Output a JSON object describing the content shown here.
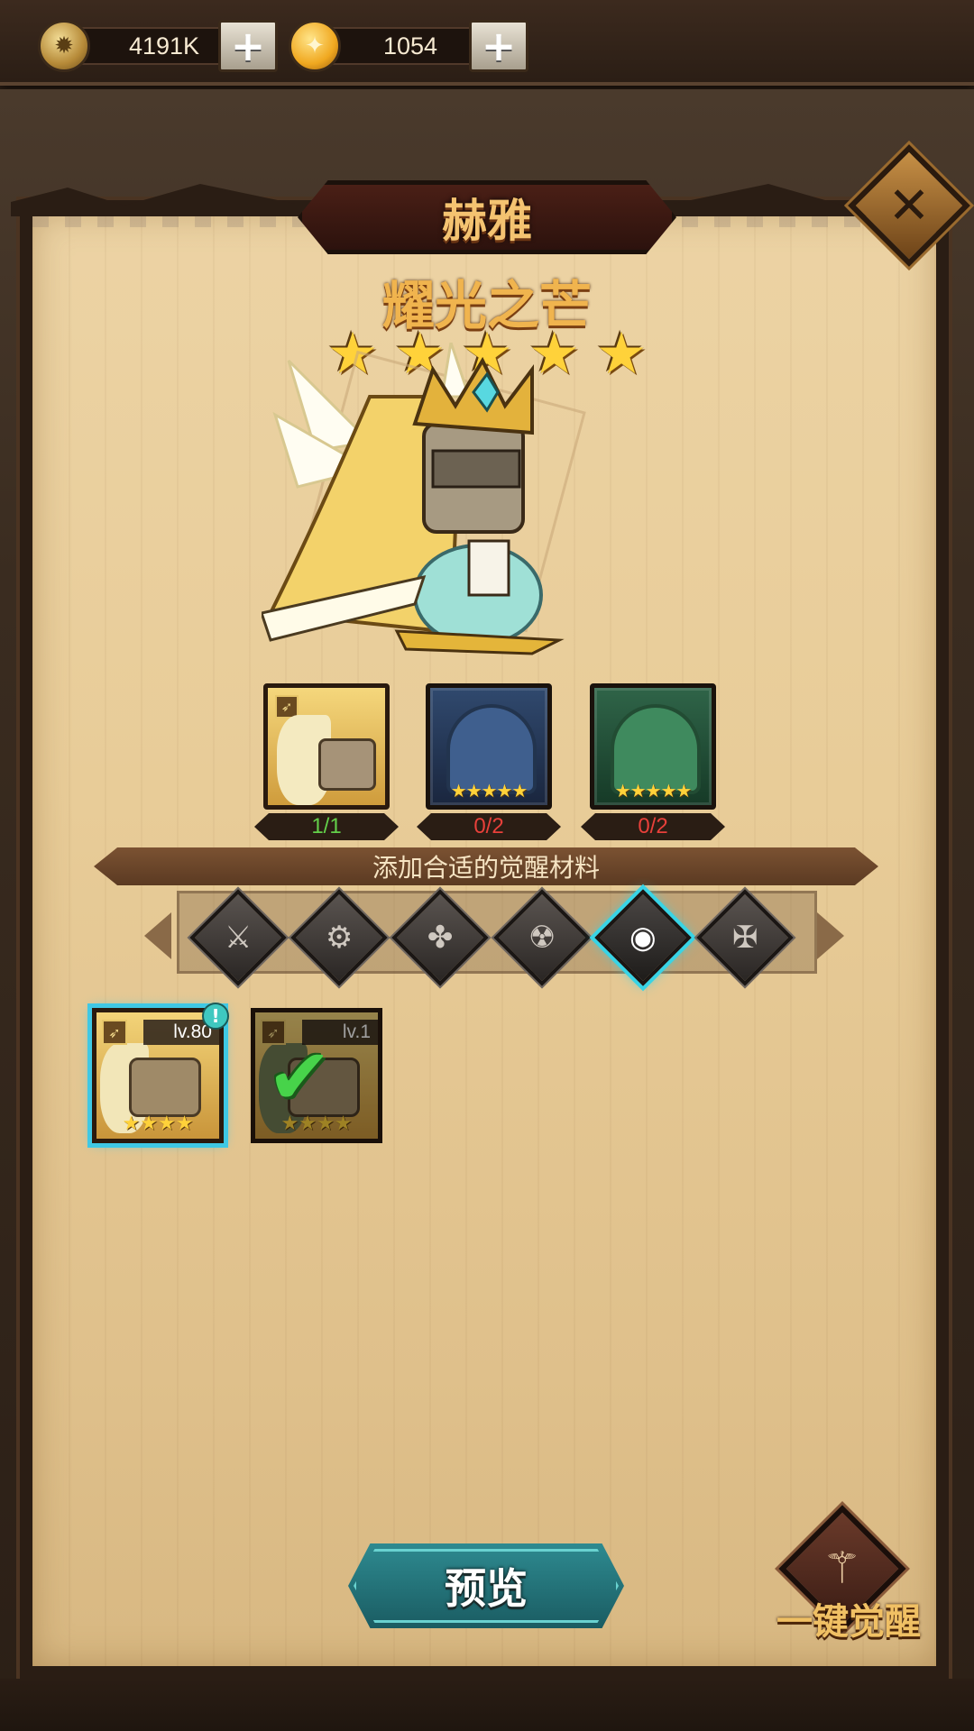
{
  "resources": {
    "stone": {
      "value": "4191K",
      "icon": "stone-coin-icon"
    },
    "gold": {
      "value": "1054",
      "icon": "gold-coin-icon"
    },
    "plus_label": "+"
  },
  "panel": {
    "title": "赫雅",
    "subtitle": "耀光之芒",
    "star_count": 5,
    "close_label": "✕"
  },
  "materials": [
    {
      "name": "hero-self",
      "count": "1/1",
      "status": "ok",
      "stars": ""
    },
    {
      "name": "blue-any",
      "count": "0/2",
      "status": "missing",
      "stars": "★★★★★"
    },
    {
      "name": "green-any",
      "count": "0/2",
      "status": "missing",
      "stars": "★★★★★"
    }
  ],
  "hint": "添加合适的觉醒材料",
  "factions": [
    {
      "icon": "sword-faction-icon",
      "glyph": "⚔",
      "active": false
    },
    {
      "icon": "gear-faction-icon",
      "glyph": "⚙",
      "active": false
    },
    {
      "icon": "clover-faction-icon",
      "glyph": "✤",
      "active": false
    },
    {
      "icon": "beast-faction-icon",
      "glyph": "☢",
      "active": false
    },
    {
      "icon": "eye-faction-icon",
      "glyph": "◉",
      "active": true
    },
    {
      "icon": "demon-faction-icon",
      "glyph": "✠",
      "active": false
    }
  ],
  "hero_cards": [
    {
      "level": "lv.80",
      "stars": "★★★★",
      "selected": true,
      "dim": false,
      "badge": "!"
    },
    {
      "level": "lv.1",
      "stars": "★★★★",
      "selected": false,
      "dim": true,
      "check": "✔"
    }
  ],
  "buttons": {
    "preview": "预览",
    "auto_awaken": "一键觉醒"
  },
  "colors": {
    "accent_cyan": "#3fc8e4",
    "title_gold": "#f0b44e",
    "ok_green": "#63d04a",
    "missing_red": "#e8403a"
  }
}
